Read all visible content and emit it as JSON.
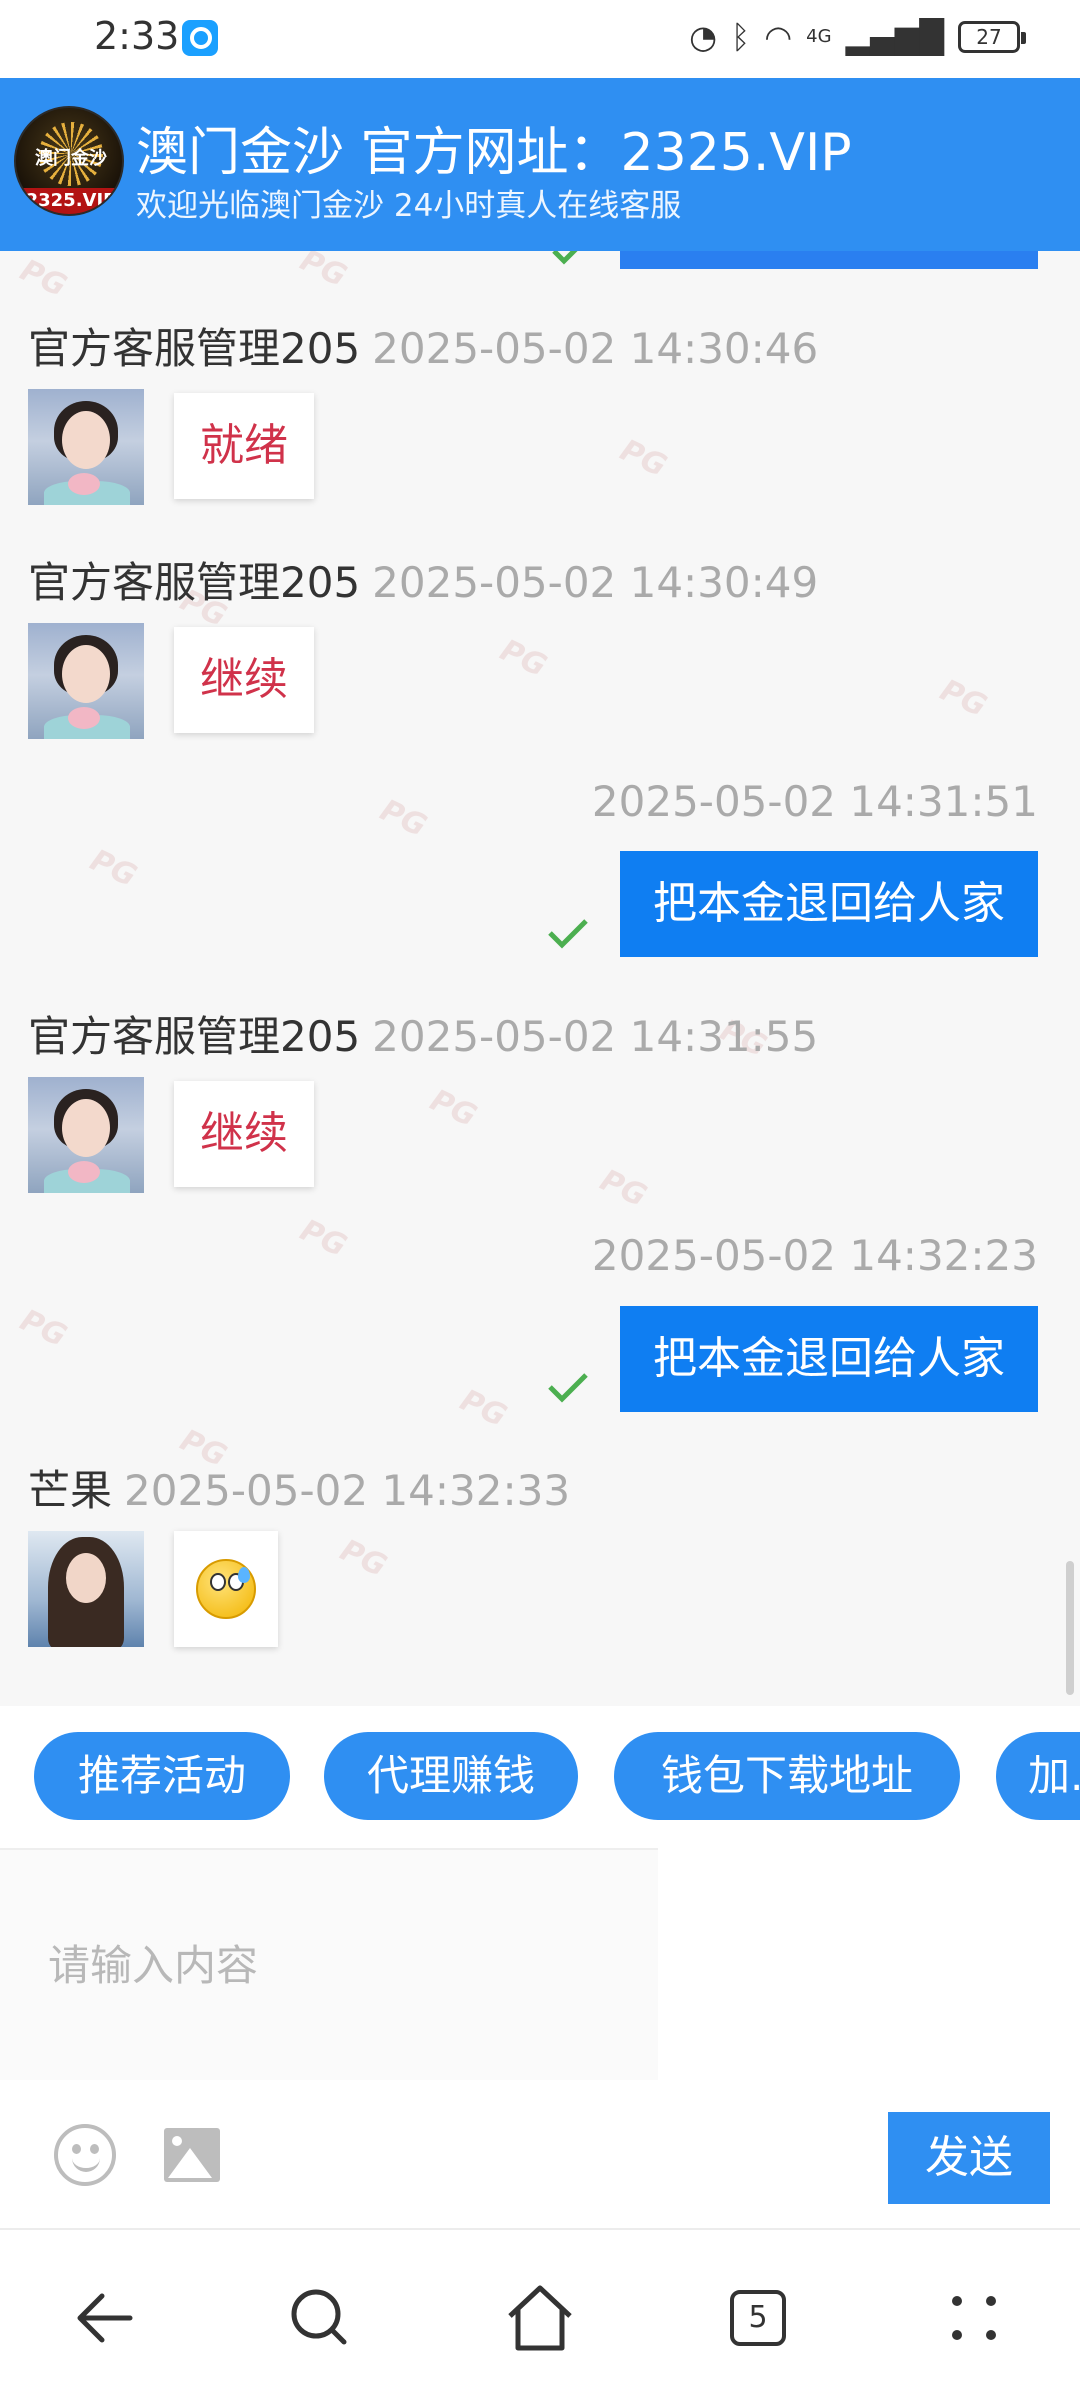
{
  "status_bar": {
    "time": "2:33",
    "indicators": [
      "speed-icon",
      "bluetooth-icon",
      "wifi-icon",
      "4g-signal-icon"
    ],
    "network_label": "4G",
    "battery": "27"
  },
  "header": {
    "logo_text": "澳门金沙",
    "logo_subtext": "2325.VIP",
    "title": "澳门金沙 官方网址：2325.VIP",
    "subtitle": "欢迎光临澳门金沙 24小时真人在线客服"
  },
  "watermark_text": "PG",
  "messages": [
    {
      "type": "incoming",
      "sender": "官方客服管理205",
      "time": "2025-05-02 14:30:46",
      "text": "就绪",
      "avatar": "avatar-service"
    },
    {
      "type": "incoming",
      "sender": "官方客服管理205",
      "time": "2025-05-02 14:30:49",
      "text": "继续",
      "avatar": "avatar-service"
    },
    {
      "type": "outgoing",
      "time": "2025-05-02 14:31:51",
      "text": "把本金退回给人家"
    },
    {
      "type": "incoming",
      "sender": "官方客服管理205",
      "time": "2025-05-02 14:31:55",
      "text": "继续",
      "avatar": "avatar-service"
    },
    {
      "type": "outgoing",
      "time": "2025-05-02 14:32:23",
      "text": "把本金退回给人家"
    },
    {
      "type": "incoming",
      "sender": "芒果",
      "time": "2025-05-02 14:32:33",
      "text": "",
      "emoji": "sweat-emoji",
      "avatar": "avatar-user"
    }
  ],
  "quick_replies": [
    "推荐活动",
    "代理赚钱",
    "钱包下载地址",
    "加..."
  ],
  "input": {
    "placeholder": "请输入内容",
    "value": ""
  },
  "send_label": "发送",
  "nav": {
    "tabs_count": "5"
  },
  "colors": {
    "primary": "#2f8ff2",
    "outgoing_bubble": "#0f7ef2",
    "incoming_text": "#d0324a",
    "check": "#4caf50"
  }
}
